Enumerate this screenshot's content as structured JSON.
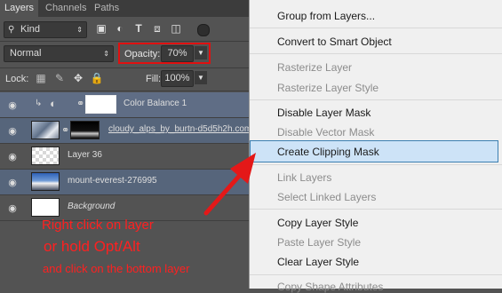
{
  "tabs": [
    "Layers",
    "Channels",
    "Paths"
  ],
  "filter": {
    "kind_label": "Kind"
  },
  "blend": {
    "mode": "Normal"
  },
  "opacity": {
    "label": "Opacity:",
    "value": "70%"
  },
  "lock": {
    "label": "Lock:"
  },
  "fill": {
    "label": "Fill:",
    "value": "100%"
  },
  "layers": [
    {
      "name": "Color Balance 1",
      "italic": false
    },
    {
      "name": "cloudy_alps_by_burtn-d5d5h2h.com",
      "italic": false
    },
    {
      "name": "Layer 36",
      "italic": false
    },
    {
      "name": "mount-everest-276995",
      "italic": false
    },
    {
      "name": "Background",
      "italic": true
    }
  ],
  "menu": {
    "items": [
      {
        "label": "Group from Layers...",
        "disabled": false
      },
      {
        "label": "Convert to Smart Object",
        "disabled": false
      },
      {
        "label": "Rasterize Layer",
        "disabled": true
      },
      {
        "label": "Rasterize Layer Style",
        "disabled": true
      },
      {
        "label": "Disable Layer Mask",
        "disabled": false
      },
      {
        "label": "Disable Vector Mask",
        "disabled": true
      },
      {
        "label": "Create Clipping Mask",
        "disabled": false,
        "highlighted": true
      },
      {
        "label": "Link Layers",
        "disabled": true
      },
      {
        "label": "Select Linked Layers",
        "disabled": true
      },
      {
        "label": "Copy Layer Style",
        "disabled": false
      },
      {
        "label": "Paste Layer Style",
        "disabled": true
      },
      {
        "label": "Clear Layer Style",
        "disabled": false
      },
      {
        "label": "Copy Shape Attributes",
        "disabled": true
      }
    ]
  },
  "annotation": {
    "line1": "Right click on layer",
    "line2": "or hold Opt/Alt",
    "line3": "and click on the bottom layer",
    "color": "#ff2020"
  },
  "colors": {
    "selected_layer": "#5f6d85",
    "menu_highlight": "#cde3f7",
    "annotation": "#ff2020"
  }
}
